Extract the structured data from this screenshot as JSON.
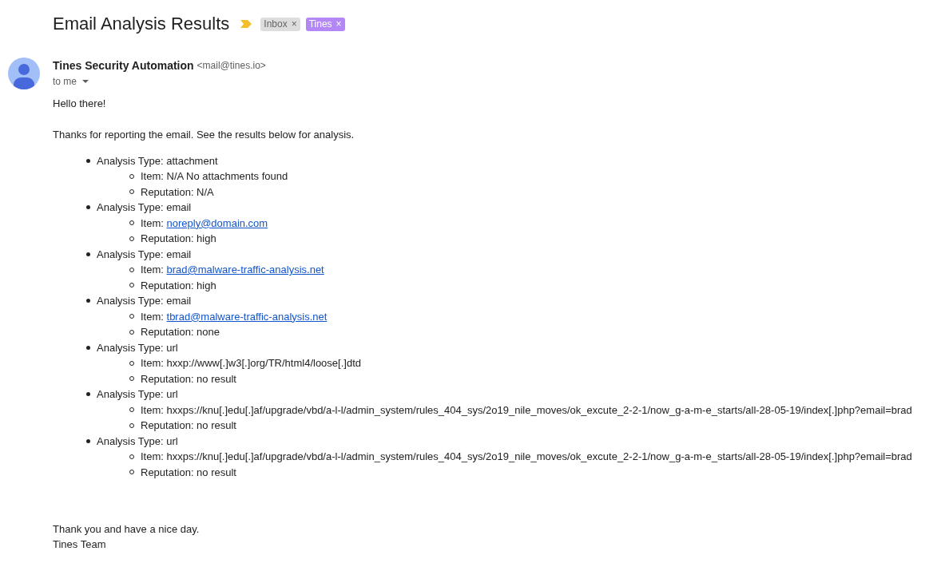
{
  "subject": "Email Analysis Results",
  "important": true,
  "labels": [
    {
      "text": "Inbox",
      "remove": "×",
      "color": "#dddddd"
    },
    {
      "text": "Tines",
      "remove": "×",
      "color": "#b388f6"
    }
  ],
  "sender": {
    "name": "Tines Security Automation",
    "address": "<mail@tines.io>"
  },
  "recipient": "to me",
  "body": {
    "greeting": "Hello there!",
    "intro": "Thanks for reporting the email. See the results below for analysis.",
    "results": [
      {
        "text": "Analysis Type: attachment",
        "children": [
          {
            "text": "Item: N/A No attachments found"
          },
          {
            "text": "Reputation: N/A"
          }
        ]
      },
      {
        "text": "Analysis Type: email",
        "children": [
          {
            "text": "Item:",
            "link": "noreply@domain.com"
          },
          {
            "text": "Reputation: high"
          }
        ]
      },
      {
        "text": "Analysis Type: email",
        "children": [
          {
            "text": "Item:",
            "link": "brad@malware-traffic-analysis.net"
          },
          {
            "text": "Reputation: high"
          }
        ]
      },
      {
        "text": "Analysis Type: email",
        "children": [
          {
            "text": "Item:",
            "link": "tbrad@malware-traffic-analysis.net"
          },
          {
            "text": "Reputation: none"
          }
        ]
      },
      {
        "text": "Analysis Type: url",
        "children": [
          {
            "text": "Item: hxxp://www[.]w3[.]org/TR/html4/loose[.]dtd"
          },
          {
            "text": "Reputation: no result"
          }
        ]
      },
      {
        "text": "Analysis Type: url",
        "children": [
          {
            "text": "Item: hxxps://knu[.]edu[.]af/upgrade/vbd/a-l-l/admin_system/rules_404_sys/2o19_nile_moves/ok_excute_2-2-1/now_g-a-m-e_starts/all-28-05-19/index[.]php?email=brad"
          },
          {
            "text": "Reputation: no result"
          }
        ]
      },
      {
        "text": "Analysis Type: url",
        "children": [
          {
            "text": "Item: hxxps://knu[.]edu[.]af/upgrade/vbd/a-l-l/admin_system/rules_404_sys/2o19_nile_moves/ok_excute_2-2-1/now_g-a-m-e_starts/all-28-05-19/index[.]php?email=brad"
          },
          {
            "text": "Reputation: no result"
          }
        ]
      }
    ],
    "closing": "Thank you and have a nice day.",
    "signature": "Tines Team"
  }
}
